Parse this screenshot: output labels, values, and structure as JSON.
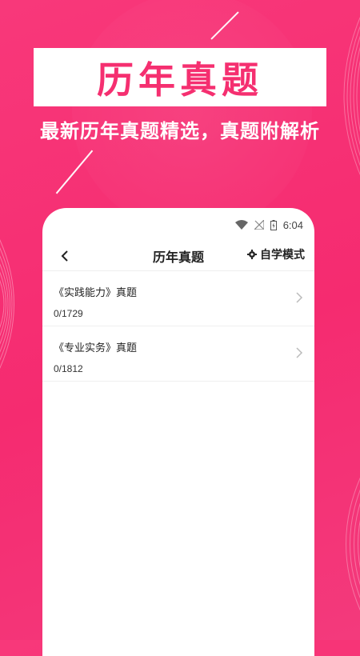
{
  "promo": {
    "title": "历年真题",
    "subtitle": "最新历年真题精选，真题附解析"
  },
  "status_bar": {
    "time": "6:04",
    "icons": [
      "wifi-icon",
      "signal-icon",
      "battery-icon"
    ]
  },
  "app_bar": {
    "title": "历年真题",
    "mode_label": "自学模式",
    "back_icon": "back-icon",
    "mode_icon": "gear-icon"
  },
  "items": [
    {
      "title": "《实践能力》真题",
      "progress": "0/1729"
    },
    {
      "title": "《专业实务》真题",
      "progress": "0/1812"
    }
  ],
  "colors": {
    "background": "#f72f72",
    "accent": "#f52f70",
    "white": "#ffffff"
  }
}
